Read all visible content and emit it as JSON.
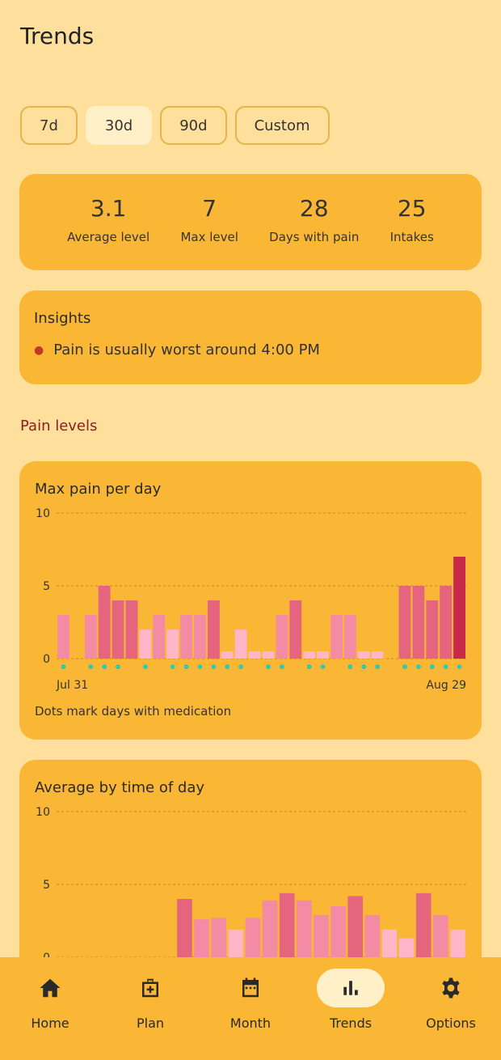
{
  "page": {
    "title": "Trends"
  },
  "ranges": [
    {
      "label": "7d",
      "selected": false
    },
    {
      "label": "30d",
      "selected": true
    },
    {
      "label": "90d",
      "selected": false
    },
    {
      "label": "Custom",
      "selected": false
    }
  ],
  "stats": [
    {
      "value": "3.1",
      "label": "Average level"
    },
    {
      "value": "7",
      "label": "Max level"
    },
    {
      "value": "28",
      "label": "Days with pain"
    },
    {
      "value": "25",
      "label": "Intakes"
    }
  ],
  "insights": {
    "title": "Insights",
    "items": [
      "Pain is usually worst around 4:00 PM"
    ]
  },
  "section": {
    "title": "Pain levels"
  },
  "chart_data": [
    {
      "type": "bar",
      "title": "Max pain per day",
      "ylim": [
        0,
        10
      ],
      "yticks": [
        "10",
        "5",
        "0"
      ],
      "x_labels": {
        "start": "Jul 31",
        "end": "Aug 29"
      },
      "values": [
        3,
        0,
        3,
        5,
        4,
        4,
        2,
        3,
        2,
        3,
        3,
        4,
        0.5,
        2,
        0.5,
        0.5,
        3,
        4,
        0.5,
        0.5,
        3,
        3,
        0.5,
        0.5,
        0,
        5,
        5,
        4,
        5,
        7
      ],
      "medication_days": [
        1,
        0,
        1,
        1,
        1,
        0,
        1,
        0,
        1,
        1,
        1,
        1,
        1,
        1,
        0,
        1,
        1,
        0,
        1,
        1,
        0,
        1,
        1,
        1,
        0,
        1,
        1,
        1,
        1,
        1
      ],
      "grid": true,
      "caption": "Dots mark days with medication",
      "colors": {
        "low": "#FFB6C8",
        "mid": "#F38BA5",
        "high": "#E5657F",
        "top": "#C8284A",
        "dot": "#3CC8A8"
      }
    },
    {
      "type": "bar",
      "title": "Average by time of day",
      "ylim": [
        0,
        10
      ],
      "yticks": [
        "10",
        "5",
        "0"
      ],
      "values": [
        0,
        0,
        0,
        0,
        0,
        0,
        0,
        4,
        2.6,
        2.7,
        1.9,
        2.7,
        3.9,
        4.4,
        3.9,
        2.9,
        3.5,
        4.2,
        2.9,
        1.9,
        1.3,
        4.4,
        2.9,
        1.9
      ],
      "grid": true
    }
  ],
  "nav": [
    {
      "label": "Home",
      "icon": "home-icon",
      "active": false
    },
    {
      "label": "Plan",
      "icon": "medical-kit-icon",
      "active": false
    },
    {
      "label": "Month",
      "icon": "calendar-icon",
      "active": false
    },
    {
      "label": "Trends",
      "icon": "bar-chart-icon",
      "active": true
    },
    {
      "label": "Options",
      "icon": "gear-icon",
      "active": false
    }
  ]
}
